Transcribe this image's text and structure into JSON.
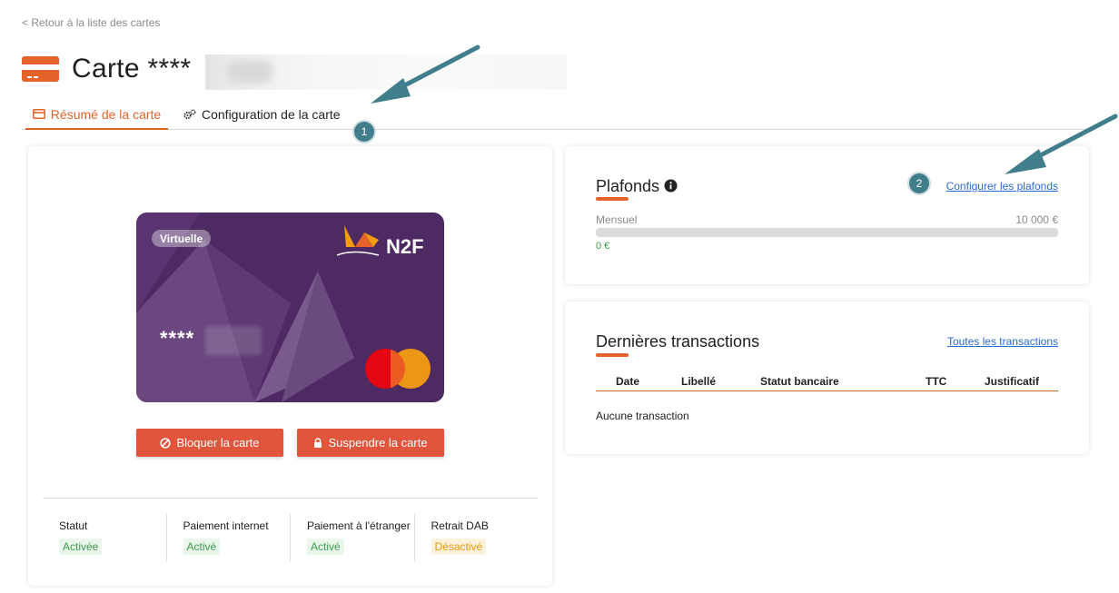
{
  "back_link": "< Retour à la liste des cartes",
  "title": "Carte ****",
  "tabs": [
    {
      "label": "Résumé de la carte"
    },
    {
      "label": "Configuration de la carte"
    }
  ],
  "annotations": {
    "badge1": "1",
    "badge2": "2"
  },
  "card": {
    "tag": "Virtuelle",
    "number": "****",
    "brand": "N2F",
    "network": "mastercard-logo"
  },
  "actions": {
    "block_label": "Bloquer la carte",
    "suspend_label": "Suspendre la carte"
  },
  "status": [
    {
      "label": "Statut",
      "value": "Activée",
      "tone": "green"
    },
    {
      "label": "Paiement internet",
      "value": "Activé",
      "tone": "green"
    },
    {
      "label": "Paiement à l'étranger",
      "value": "Activé",
      "tone": "green"
    },
    {
      "label": "Retrait DAB",
      "value": "Désactivé",
      "tone": "orange"
    }
  ],
  "limits": {
    "title": "Plafonds",
    "configure_link": "Configurer les plafonds",
    "period": "Mensuel",
    "max": "10 000 €",
    "used": "0 €",
    "used_fraction": 0
  },
  "transactions": {
    "title": "Dernières transactions",
    "all_link": "Toutes les transactions",
    "columns": [
      "Date",
      "Libellé",
      "Statut bancaire",
      "TTC",
      "Justificatif"
    ],
    "empty_text": "Aucune transaction"
  },
  "colors": {
    "accent": "#e5622b",
    "card_bg": "#4e2a62",
    "button": "#e0553b",
    "link": "#2a6bd1",
    "badge": "#3f7e8a"
  }
}
